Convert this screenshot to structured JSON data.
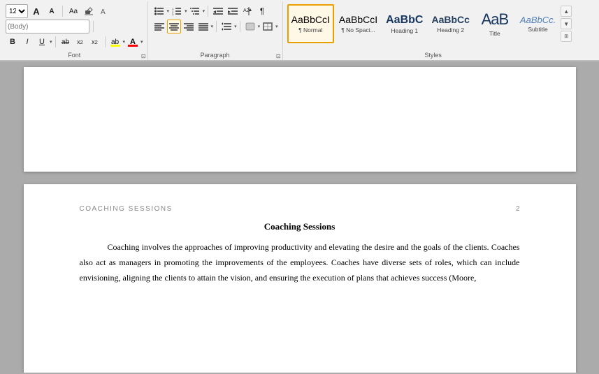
{
  "ribbon": {
    "groups": {
      "font": {
        "label": "Font",
        "font_name": "12",
        "font_size": "12",
        "font_family": "",
        "buttons": {
          "grow": "A",
          "shrink": "A",
          "change_case": "Aa",
          "clear_format": "",
          "bold": "B",
          "italic": "I",
          "underline": "U",
          "strikethrough": "abc",
          "subscript": "x₂",
          "superscript": "x²",
          "text_highlight": "ab",
          "font_color": "A"
        }
      },
      "paragraph": {
        "label": "Paragraph",
        "buttons": {
          "bullets": "≡",
          "numbering": "≡",
          "multilevel": "≡",
          "decrease_indent": "←",
          "increase_indent": "→",
          "sort": "↕",
          "pilcrow": "¶",
          "align_left": "≡",
          "align_center": "≡",
          "align_right": "≡",
          "justify": "≡",
          "line_spacing": "↕",
          "shading": "▭",
          "borders": "▭"
        }
      },
      "styles": {
        "label": "Styles",
        "items": [
          {
            "id": "normal",
            "preview": "AaBbCcI",
            "label": "¶ Normal",
            "active": true,
            "class": "normal-preview"
          },
          {
            "id": "no_spacing",
            "preview": "AaBbCcI",
            "label": "¶ No Spaci...",
            "active": false,
            "class": "nospace-preview"
          },
          {
            "id": "heading1",
            "preview": "AaBbC",
            "label": "Heading 1",
            "active": false,
            "class": "h1-preview"
          },
          {
            "id": "heading2",
            "preview": "AaBbCc",
            "label": "Heading 2",
            "active": false,
            "class": "h2-preview"
          },
          {
            "id": "title",
            "preview": "AaB",
            "label": "Title",
            "active": false,
            "class": "title-preview"
          },
          {
            "id": "subtitle",
            "preview": "AaBbCc.",
            "label": "Subtitle",
            "active": false,
            "class": "subtitle-preview"
          }
        ]
      }
    }
  },
  "document": {
    "page1": {
      "content": ""
    },
    "page2": {
      "header_left": "COACHING SESSIONS",
      "page_number": "2",
      "title": "Coaching Sessions",
      "body_text": "Coaching involves the approaches of improving productivity and elevating the desire and the goals of the clients. Coaches also act as managers in promoting the improvements of the employees. Coaches have diverse sets of roles, which can include envisioning, aligning the clients to attain the vision, and ensuring the execution of plans that achieves success (Moore,"
    }
  }
}
